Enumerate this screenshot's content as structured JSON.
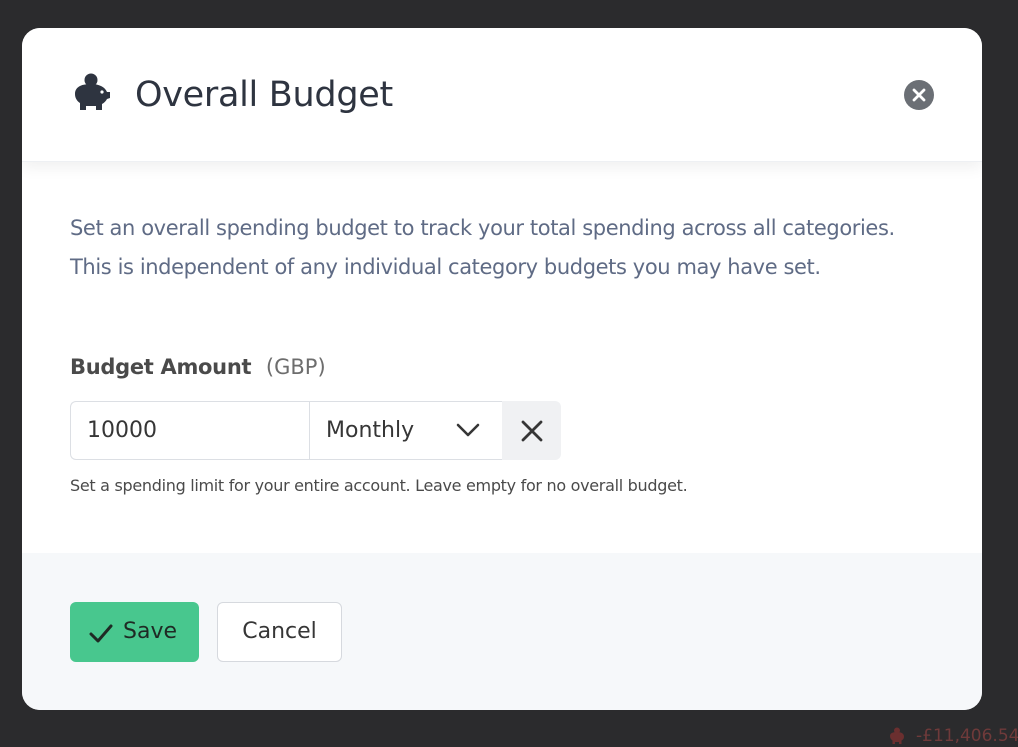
{
  "modal": {
    "title": "Overall Budget",
    "title_icon": "piggy-bank-icon",
    "close_icon": "close-circle-icon",
    "description": "Set an overall spending budget to track your total spending across all categories. This is independent of any individual category budgets you may have set.",
    "field": {
      "label": "Budget Amount",
      "unit": "(GBP)",
      "amount_value": "10000",
      "period_selected": "Monthly",
      "period_icon": "chevron-down-icon",
      "clear_icon": "close-icon",
      "help_text": "Set a spending limit for your entire account. Leave empty for no overall budget."
    },
    "footer": {
      "save_label": "Save",
      "save_icon": "checkmark-icon",
      "cancel_label": "Cancel"
    }
  },
  "background": {
    "peek_amount": "-£11,406.54",
    "peek_icon": "piggy-bank-icon"
  },
  "colors": {
    "backdrop": "#2b2b2d",
    "primary_success": "#48c78e",
    "text_muted": "#5f6b85",
    "footer_bg": "#f6f8fa"
  }
}
